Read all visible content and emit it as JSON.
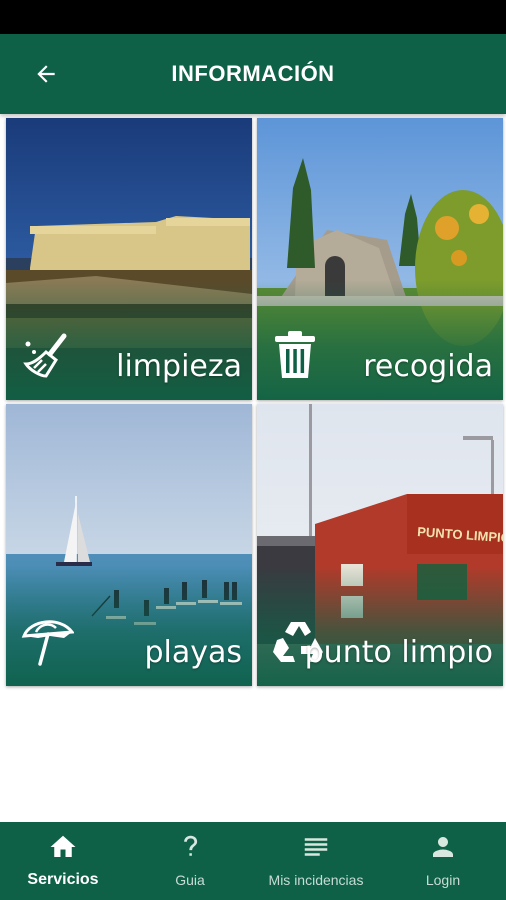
{
  "header": {
    "title": "INFORMACIÓN",
    "back_icon": "arrow-left-icon"
  },
  "tiles": [
    {
      "label": "limpieza",
      "icon": "broom-icon"
    },
    {
      "label": "recogida",
      "icon": "trash-can-icon"
    },
    {
      "label": "playas",
      "icon": "beach-umbrella-icon"
    },
    {
      "label": "punto limpio",
      "icon": "recycle-icon",
      "sign_text": "PUNTO LIMPIO"
    }
  ],
  "bottom_nav": {
    "items": [
      {
        "label": "Servicios",
        "icon": "home-icon",
        "active": true
      },
      {
        "label": "Guia",
        "icon": "question-icon",
        "active": false
      },
      {
        "label": "Mis incidencias",
        "icon": "list-icon",
        "active": false
      },
      {
        "label": "Login",
        "icon": "user-icon",
        "active": false
      }
    ]
  },
  "colors": {
    "primary": "#0e6147",
    "nav_inactive_text": "#c7dcd4",
    "background": "#ffffff"
  }
}
